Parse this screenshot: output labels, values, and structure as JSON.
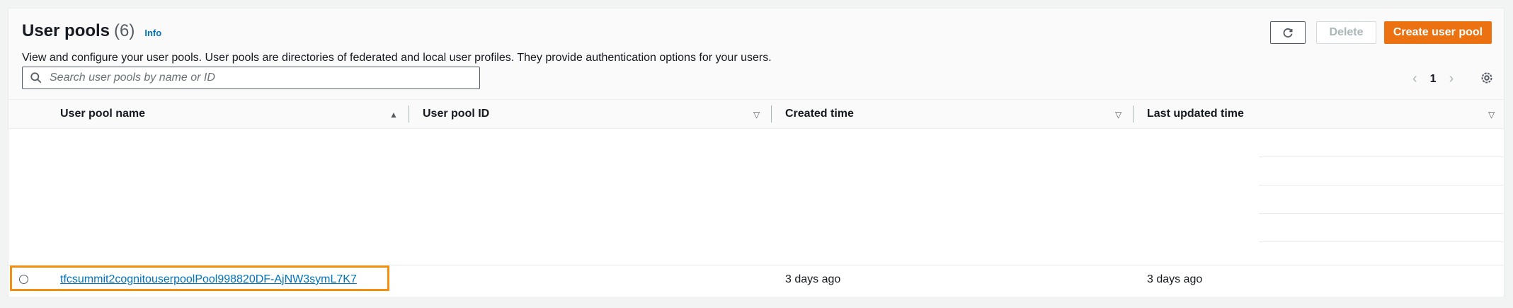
{
  "header": {
    "title": "User pools",
    "count": "(6)",
    "info_label": "Info",
    "description": "View and configure your user pools. User pools are directories of federated and local user profiles. They provide authentication options for your users."
  },
  "actions": {
    "delete_label": "Delete",
    "create_label": "Create user pool"
  },
  "search": {
    "placeholder": "Search user pools by name or ID",
    "value": ""
  },
  "pagination": {
    "current_page": "1"
  },
  "table": {
    "columns": [
      "User pool name",
      "User pool ID",
      "Created time",
      "Last updated time"
    ],
    "rows": [
      {
        "name": "tfcsummit2cognitouserpoolPool998820DF-AjNW3symL7K7",
        "id": "",
        "created": "3 days ago",
        "updated": "3 days ago"
      }
    ]
  },
  "colors": {
    "accent": "#ec7211",
    "link": "#0073bb",
    "highlight": "#f29111"
  },
  "icons": [
    "refresh-icon",
    "search-icon",
    "chevron-left-icon",
    "chevron-right-icon",
    "settings-icon",
    "sort-ascending-icon",
    "sort-descending-icon"
  ]
}
